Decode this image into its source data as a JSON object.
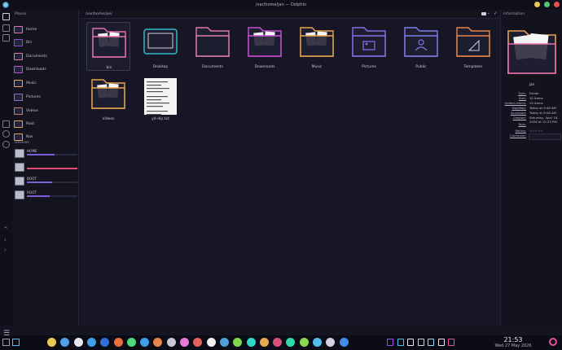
{
  "window": {
    "title": "/var/home/jan — Dolphin"
  },
  "places": {
    "title": "Places",
    "items": [
      {
        "label": "Home",
        "color": "#e86fb0"
      },
      {
        "label": "Bin",
        "color": "#8a4fd8"
      },
      {
        "label": "Documents",
        "color": "#e07aa8"
      },
      {
        "label": "Downloads",
        "color": "#c84fd8"
      },
      {
        "label": "Music",
        "color": "#e8a64f"
      },
      {
        "label": "Pictures",
        "color": "#8a6fe8"
      },
      {
        "label": "Videos",
        "color": "#d87a5f"
      },
      {
        "label": "Root",
        "color": "#e8a04f"
      },
      {
        "label": "Nas",
        "color": "#e8a04f"
      }
    ],
    "devices_title": "Devices",
    "devices": [
      {
        "label": "HOME",
        "usage": 0.55,
        "color": "#7c5fd8"
      },
      {
        "label": "",
        "usage": 1.0,
        "color": "#e24a7a"
      },
      {
        "label": "BOOT",
        "usage": 0.5,
        "color": "#7c5fd8"
      },
      {
        "label": "ROOT",
        "usage": 0.45,
        "color": "#7c5fd8"
      }
    ]
  },
  "pathbar": {
    "path": "/var/home/jan/"
  },
  "files": [
    {
      "label": "bin",
      "kind": "folder-docs",
      "accent": "#e86fb0"
    },
    {
      "label": "Desktop",
      "kind": "desktop",
      "accent": "#2fb9c8"
    },
    {
      "label": "Documents",
      "kind": "folder",
      "accent": "#e07aa8"
    },
    {
      "label": "Downloads",
      "kind": "folder-docs",
      "accent": "#c84fd8"
    },
    {
      "label": "Music",
      "kind": "folder-docs",
      "accent": "#e8a64f"
    },
    {
      "label": "Pictures",
      "kind": "folder-pic",
      "accent": "#8a6fe8"
    },
    {
      "label": "Public",
      "kind": "folder-user",
      "accent": "#7c7fe8"
    },
    {
      "label": "Templates",
      "kind": "folder-tpl",
      "accent": "#e8854f"
    },
    {
      "label": "Videos",
      "kind": "folder-docs",
      "accent": "#e8a64f"
    },
    {
      "label": "y4-dlp.txt",
      "kind": "textfile",
      "accent": "#ffffff"
    }
  ],
  "info": {
    "title": "Information",
    "name": "jan",
    "rows": [
      {
        "k": "Type:",
        "v": "Folder"
      },
      {
        "k": "Size:",
        "v": "10 items"
      },
      {
        "k": "Hidden items:",
        "v": "19 items"
      },
      {
        "k": "Modified:",
        "v": "Today at 9:46 AM"
      },
      {
        "k": "Accessed:",
        "v": "Today at 9:46 AM"
      },
      {
        "k": "Created:",
        "v": "Saturday, April 18, 2026 at 12:23 PM"
      },
      {
        "k": "Tags:",
        "v": ""
      },
      {
        "k": "Rating:",
        "v": "☆☆☆☆☆"
      },
      {
        "k": "Comment:",
        "v": ""
      }
    ]
  },
  "taskbar": {
    "time": "21:53",
    "date": "Wed 27 May 2026"
  }
}
